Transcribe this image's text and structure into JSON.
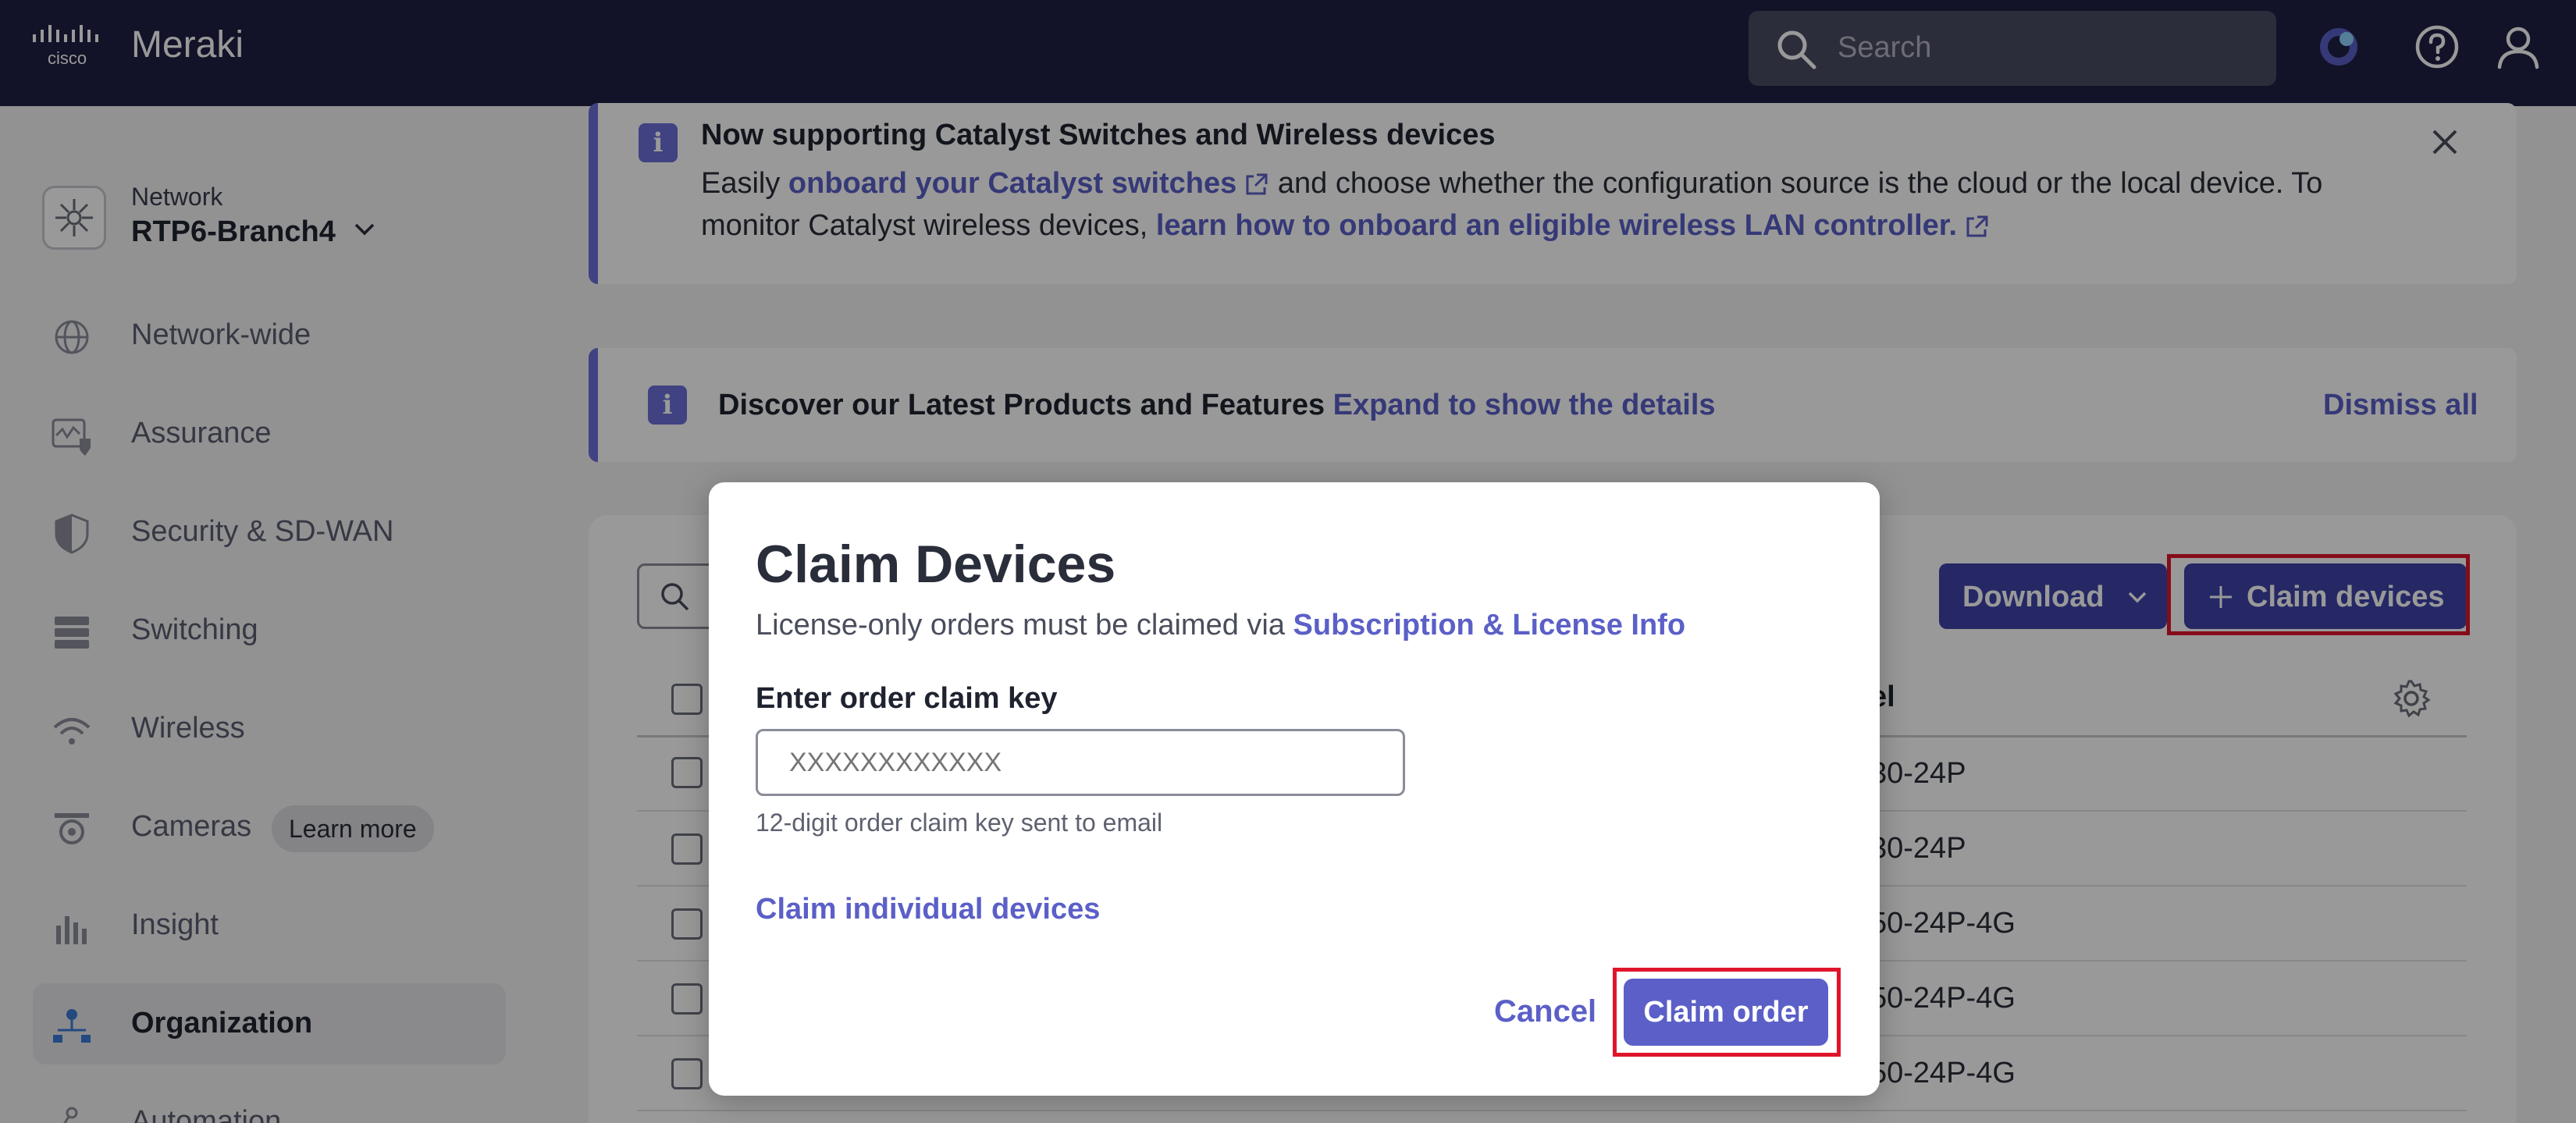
{
  "topbar": {
    "brand": "Meraki",
    "logo_text": "cisco",
    "search_placeholder": "Search"
  },
  "sidebar": {
    "network_label": "Network",
    "network_name": "RTP6-Branch4",
    "items": [
      {
        "label": "Network-wide",
        "icon": "globe-icon"
      },
      {
        "label": "Assurance",
        "icon": "assurance-icon"
      },
      {
        "label": "Security & SD-WAN",
        "icon": "shield-icon"
      },
      {
        "label": "Switching",
        "icon": "switch-icon"
      },
      {
        "label": "Wireless",
        "icon": "wifi-icon"
      },
      {
        "label": "Cameras",
        "icon": "camera-icon",
        "badge": "Learn more"
      },
      {
        "label": "Insight",
        "icon": "bar-chart-icon"
      },
      {
        "label": "Organization",
        "icon": "org-icon",
        "active": true
      },
      {
        "label": "Automation",
        "icon": "automation-icon"
      }
    ]
  },
  "banner1": {
    "title": "Now supporting Catalyst Switches and Wireless devices",
    "t1": "Easily ",
    "link1": "onboard your Catalyst switches",
    "t2": " and choose whether the configuration source is the cloud or the local device. To monitor Catalyst wireless devices, ",
    "link2": "learn how to onboard an eligible wireless LAN controller."
  },
  "banner2": {
    "title": "Discover our Latest Products and Features",
    "link": "Expand to show the details",
    "dismiss": "Dismiss all"
  },
  "toolbar": {
    "download": "Download",
    "claim_devices": "Claim devices"
  },
  "table": {
    "model_header_partial": "el",
    "rows": [
      "30-24P",
      "30-24P",
      "50-24P-4G",
      "50-24P-4G",
      "50-24P-4G"
    ]
  },
  "modal": {
    "title": "Claim Devices",
    "subtitle_text": "License-only orders must be claimed via ",
    "subtitle_link": "Subscription & License Info",
    "label": "Enter order claim key",
    "placeholder": "XXXXXXXXXXXX",
    "help": "12-digit order claim key sent to email",
    "individual_link": "Claim individual devices",
    "cancel": "Cancel",
    "claim_order": "Claim order"
  },
  "colors": {
    "topbar": "#1e2043",
    "accent": "#5b5fc7",
    "button_dark": "#3f43a8",
    "highlight": "#e0142b"
  }
}
